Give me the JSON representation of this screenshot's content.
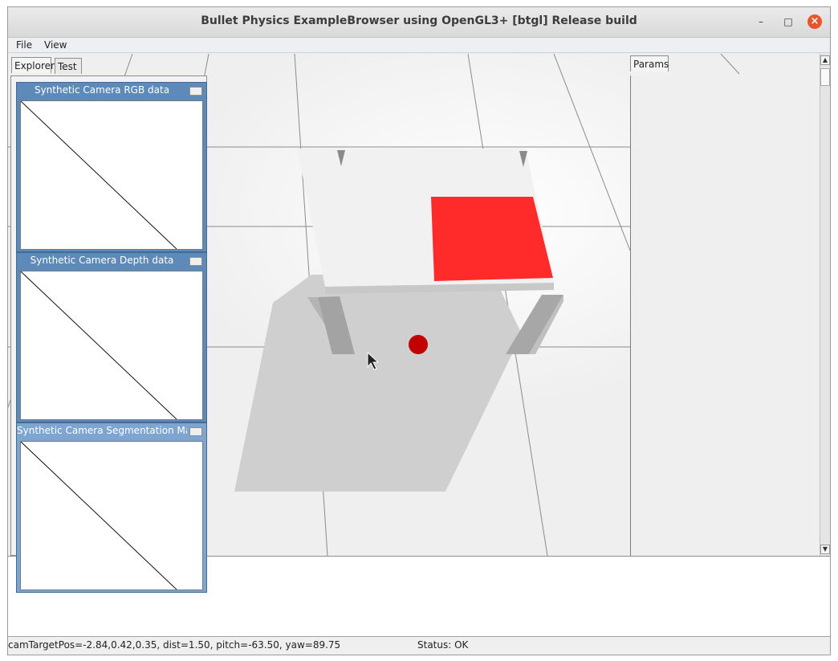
{
  "window": {
    "title": "Bullet Physics ExampleBrowser using OpenGL3+ [btgl] Release build",
    "controls": {
      "minimize": "–",
      "maximize": "□",
      "close": "×"
    }
  },
  "menu": {
    "file": "File",
    "view": "View"
  },
  "left_tabs": {
    "explorer": "Explorer",
    "test": "Test"
  },
  "params_tab": "Params",
  "cameras": [
    {
      "title": "Synthetic Camera RGB data"
    },
    {
      "title": "Synthetic Camera Depth data"
    },
    {
      "title": "Synthetic Camera Segmentation Mask"
    }
  ],
  "status": {
    "camera": "camTargetPos=-2.84,0.42,0.35, dist=1.50, pitch=-63.50, yaw=89.75",
    "state": "Status: OK"
  },
  "colors": {
    "cube": "#ff2b2b",
    "sphere": "#c10000",
    "floor": "#efefef",
    "panel_blue": "#5d8ab8"
  },
  "icons": {
    "scroll_up": "▲",
    "scroll_down": "▼"
  }
}
